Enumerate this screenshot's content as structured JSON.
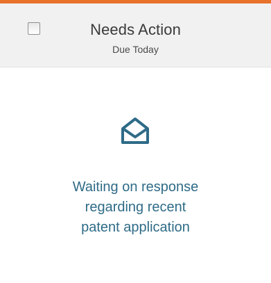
{
  "header": {
    "title": "Needs Action",
    "subtitle": "Due Today",
    "select_checkbox_checked": false
  },
  "content": {
    "icon": "open-envelope-icon",
    "message_lines": [
      "Waiting on response",
      "regarding recent",
      "patent application"
    ]
  },
  "colors": {
    "accent": "#e8712c",
    "header_bg": "#f1f1f1",
    "icon": "#2e6b87",
    "message_text": "#2e6b87"
  }
}
